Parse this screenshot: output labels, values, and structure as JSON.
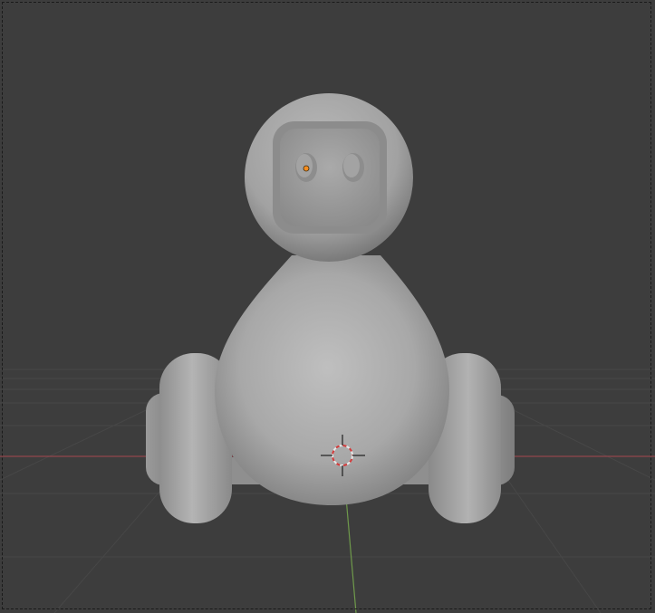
{
  "viewport": {
    "background": "#3d3d3d",
    "grid_color": "#4a4a4a",
    "x_axis_color": "#a6464f",
    "y_axis_color": "#6f9a4b"
  },
  "scene": {
    "object": "robot-model",
    "object_color": "#a9a9a9",
    "origin_color": "#f58d1f",
    "cursor_colors": [
      "#e8e8e8",
      "#d43a3a"
    ]
  }
}
